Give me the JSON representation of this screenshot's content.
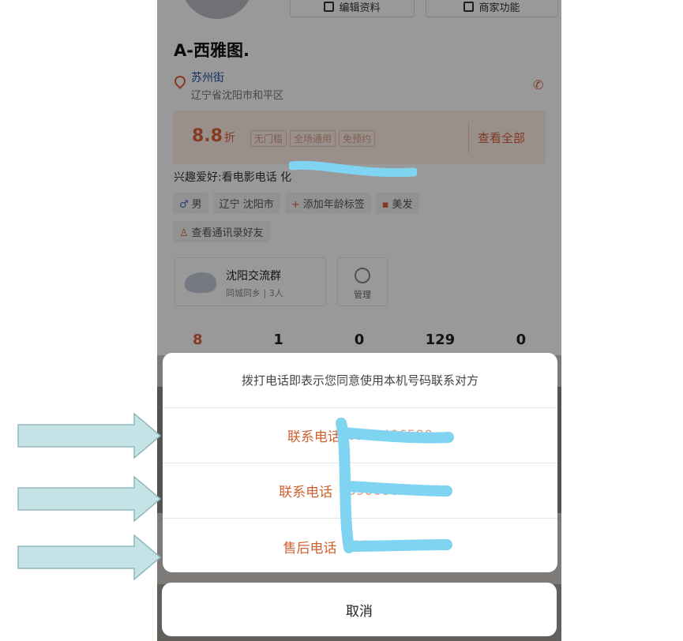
{
  "profile": {
    "edit_button": "编辑资料",
    "business_button": "商家功能",
    "name": "A-西雅图.",
    "location_name": "苏州街",
    "location_address": "辽宁省沈阳市和平区",
    "discount": {
      "value": "8.8",
      "unit": "折",
      "tags": [
        "无门槛",
        "全场通用",
        "免预约"
      ],
      "view_all": "查看全部"
    },
    "hobby": "兴趣爱好:看电影电话 化",
    "tags_row1": [
      {
        "icon": "male-icon",
        "symbol": "♂",
        "label": "男"
      },
      {
        "icon": "",
        "symbol": "",
        "label": "辽宁 沈阳市"
      },
      {
        "icon": "plus-icon",
        "symbol": "+",
        "label": "添加年龄标签"
      },
      {
        "icon": "hair-icon",
        "symbol": "▪",
        "label": "美发"
      }
    ],
    "tags_row2": [
      {
        "icon": "contacts-icon",
        "symbol": "♙",
        "label": "查看通讯录好友"
      }
    ],
    "group": {
      "name": "沈阳交流群",
      "meta": "同城同乡 | 3人",
      "manage_label": "管理"
    },
    "stats": [
      "8",
      "1",
      "0",
      "129",
      "0"
    ]
  },
  "dialog": {
    "header": "拨打电话即表示您同意使用本机号码联系对方",
    "options": [
      {
        "label": "联系电话",
        "number": "0240406590"
      },
      {
        "label": "联系电话",
        "number": "139000000003"
      },
      {
        "label": "售后电话",
        "number": "10000000003"
      }
    ],
    "cancel": "取消"
  },
  "annotation": {
    "arrow_color": "#c5e2e6",
    "arrow_border": "#8fb8be",
    "scribble_color": "#7fd4f2",
    "scribble_letter": "E"
  },
  "colors": {
    "accent": "#e0623a",
    "option_text": "#d06030",
    "link_blue": "#1f4fa0"
  }
}
